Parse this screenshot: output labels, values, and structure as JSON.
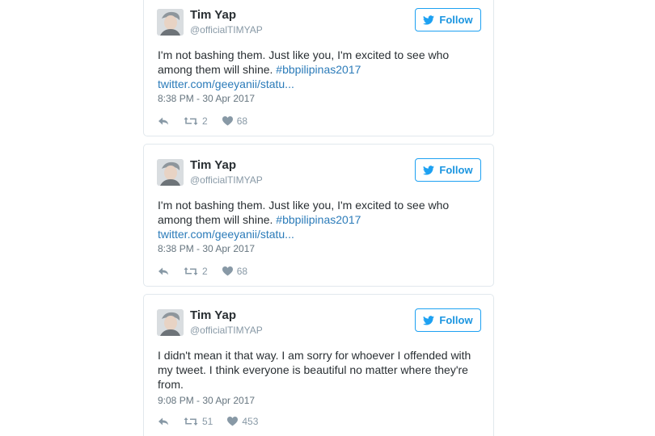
{
  "tweets": [
    {
      "name": "Tim Yap",
      "handle": "@officialTIMYAP",
      "follow_label": "Follow",
      "text": "I'm not bashing them. Just like you, I'm excited to see who among them will shine.",
      "hashtag": "#bbpilipinas2017",
      "link": "twitter.com/geeyanii/statu...",
      "timestamp": "8:38 PM - 30 Apr 2017",
      "retweets": "2",
      "likes": "68"
    },
    {
      "name": "Tim Yap",
      "handle": "@officialTIMYAP",
      "follow_label": "Follow",
      "text": "I'm not bashing them. Just like you, I'm excited to see who among them will shine.",
      "hashtag": "#bbpilipinas2017",
      "link": "twitter.com/geeyanii/statu...",
      "timestamp": "8:38 PM - 30 Apr 2017",
      "retweets": "2",
      "likes": "68"
    },
    {
      "name": "Tim Yap",
      "handle": "@officialTIMYAP",
      "follow_label": "Follow",
      "text": "I didn't mean it that way. I am sorry for whoever I offended with my tweet. I think everyone is beautiful no matter where they're from.",
      "timestamp": "9:08 PM - 30 Apr 2017",
      "retweets": "51",
      "likes": "453"
    }
  ],
  "icons": {
    "bird": "twitter-bird-icon",
    "reply": "reply-icon",
    "retweet": "retweet-icon",
    "like": "heart-icon"
  },
  "colors": {
    "accent": "#1da1f2",
    "link": "#2b7bb9",
    "text": "#292f33",
    "muted": "#8899a6"
  }
}
